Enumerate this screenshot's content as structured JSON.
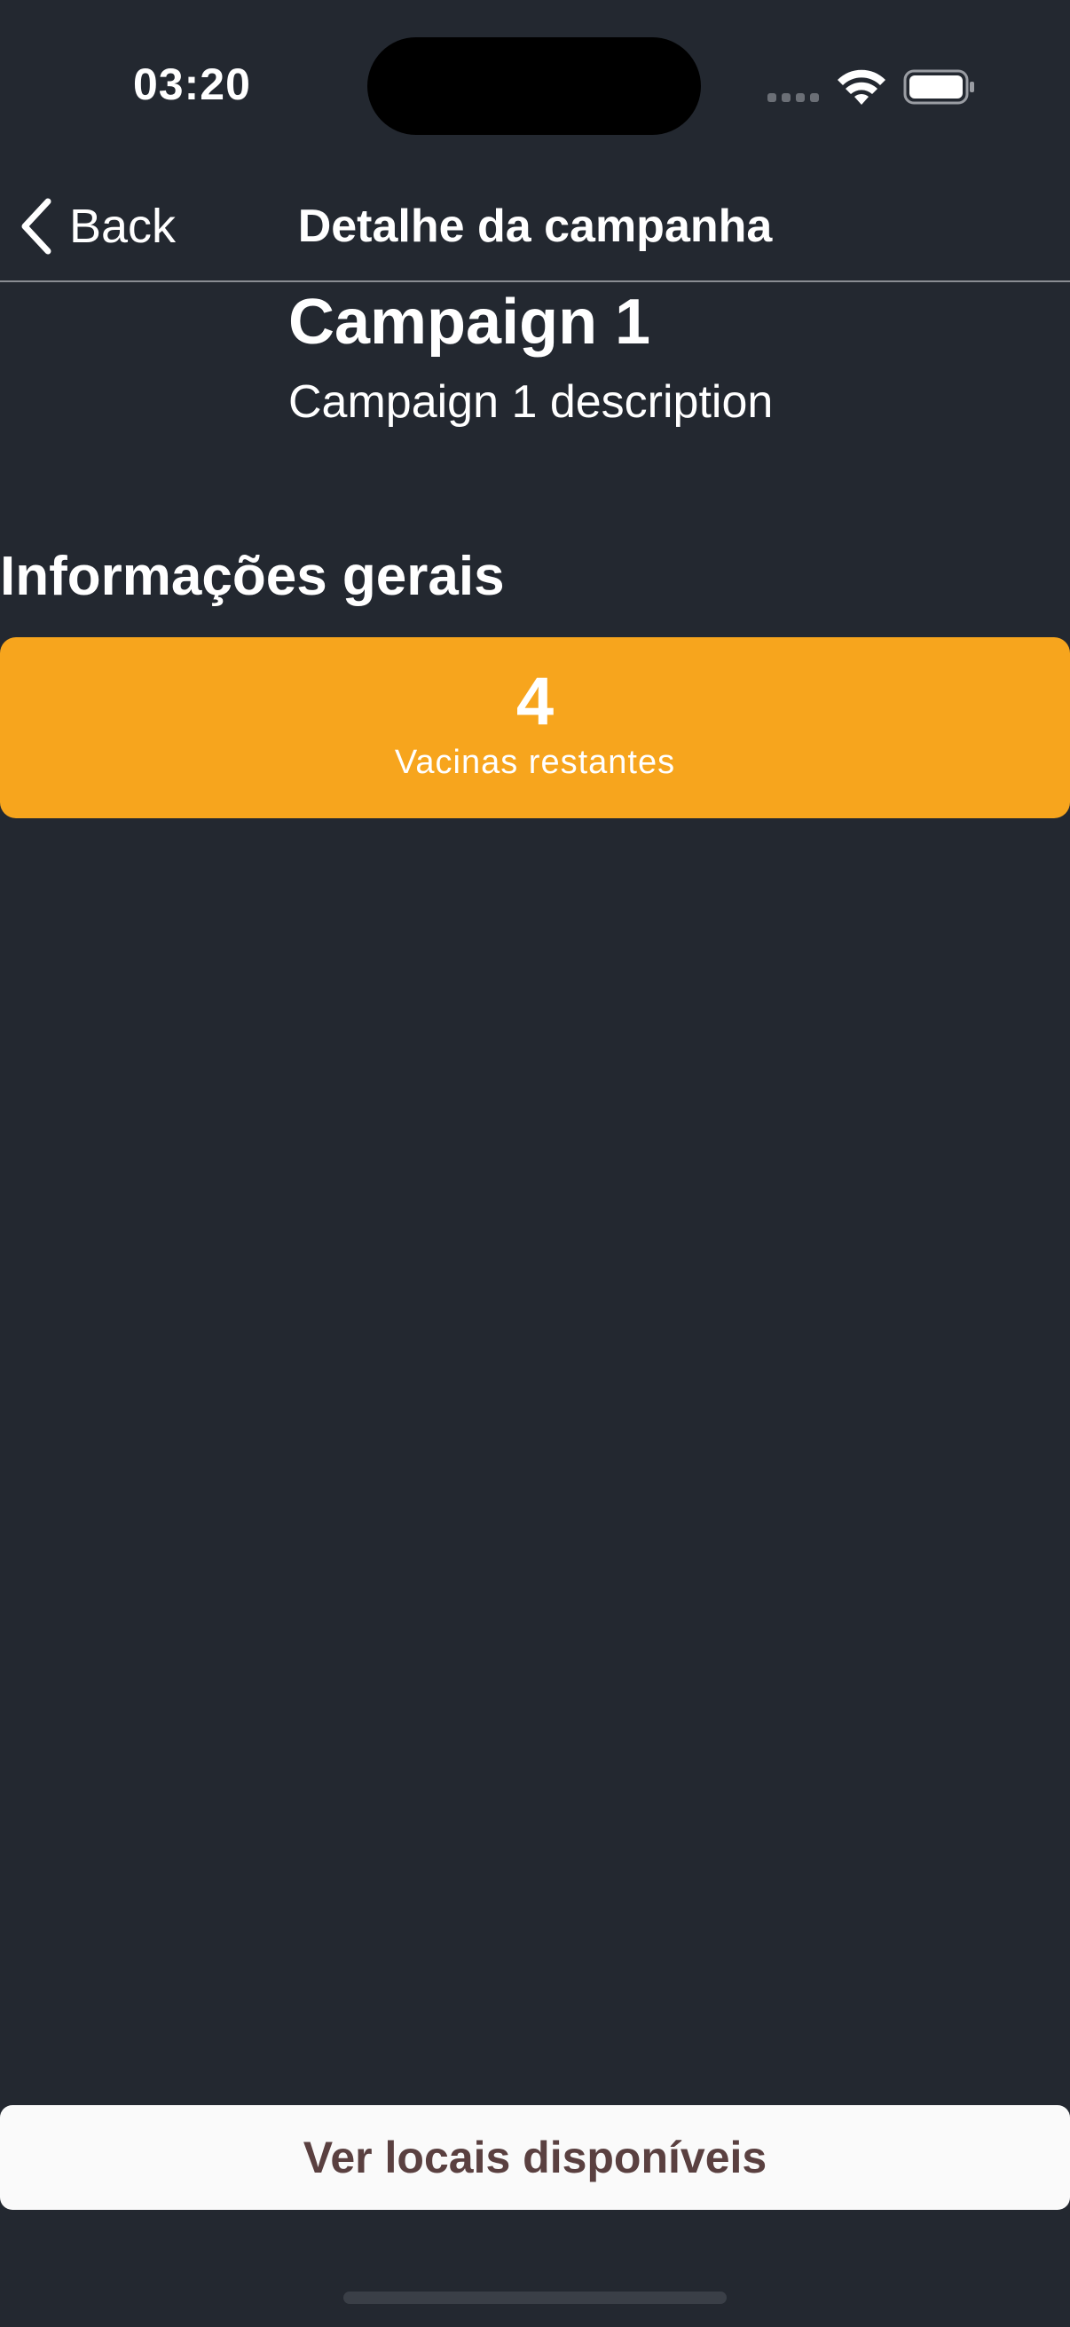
{
  "status_bar": {
    "time": "03:20"
  },
  "nav": {
    "back_label": "Back",
    "title": "Detalhe da campanha"
  },
  "campaign": {
    "title": "Campaign 1",
    "description": "Campaign 1 description"
  },
  "general_info": {
    "heading": "Informações gerais",
    "stat": {
      "value": "4",
      "label": "Vacinas restantes"
    }
  },
  "footer": {
    "cta_label": "Ver locais disponíveis"
  },
  "colors": {
    "background": "#232830",
    "accent": "#f7a51d",
    "cta_text": "#5a4040"
  },
  "icons": [
    "chevron-left-icon",
    "wifi-icon",
    "battery-icon",
    "signal-icon"
  ]
}
